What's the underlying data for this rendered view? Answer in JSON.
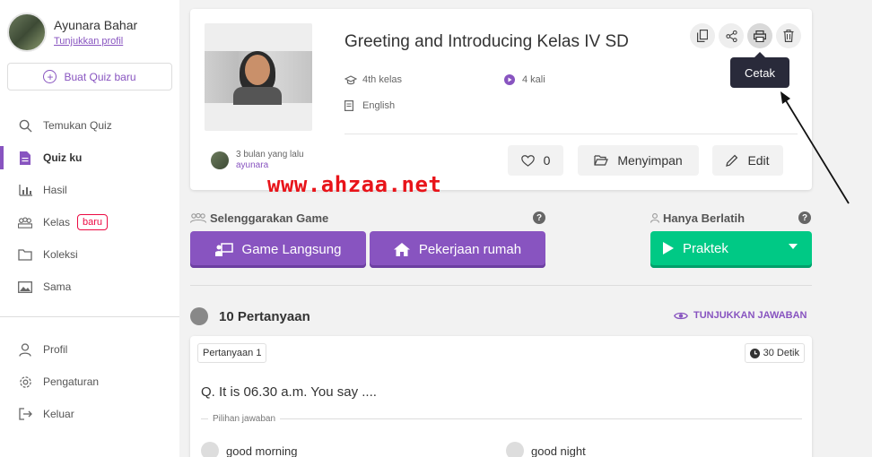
{
  "sidebar": {
    "user_name": "Ayunara Bahar",
    "profile_link": "Tunjukkan profil",
    "create_label": "Buat Quiz baru",
    "items": [
      {
        "label": "Temukan Quiz",
        "icon": "search-icon"
      },
      {
        "label": "Quiz ku",
        "icon": "document-icon",
        "active": true
      },
      {
        "label": "Hasil",
        "icon": "bar-chart-icon"
      },
      {
        "label": "Kelas",
        "icon": "class-group-icon",
        "badge": "baru"
      },
      {
        "label": "Koleksi",
        "icon": "folder-icon"
      },
      {
        "label": "Sama",
        "icon": "image-icon"
      },
      {
        "label": "Profil",
        "icon": "user-icon"
      },
      {
        "label": "Pengaturan",
        "icon": "gear-icon"
      },
      {
        "label": "Keluar",
        "icon": "logout-icon"
      }
    ]
  },
  "quiz": {
    "title": "Greeting and Introducing Kelas IV SD",
    "grade": "4th kelas",
    "plays": "4 kali",
    "subject": "English",
    "author_time": "3 bulan yang lalu",
    "author_name": "ayunara",
    "likes": "0",
    "save_label": "Menyimpan",
    "edit_label": "Edit",
    "tooltip": "Cetak"
  },
  "watermark": "www.ahzaa.net",
  "host": {
    "label": "Selenggarakan Game",
    "live_label": "Game Langsung",
    "homework_label": "Pekerjaan rumah",
    "practice_section": "Hanya Berlatih",
    "practice_label": "Praktek"
  },
  "questions": {
    "count_label": "10 Pertanyaan",
    "show_answers": "TUNJUKKAN JAWABAN",
    "first": {
      "tag": "Pertanyaan 1",
      "time": "30 Detik",
      "text": "Q. It is 06.30 a.m. You say ....",
      "choices_label": "Pilihan jawaban",
      "choices": [
        "good morning",
        "good night"
      ]
    }
  },
  "colors": {
    "accent": "#8854c0",
    "practice": "#00c985",
    "tooltip_bg": "#292a3a",
    "badge": "#ec0b43",
    "watermark": "#e8141a"
  }
}
